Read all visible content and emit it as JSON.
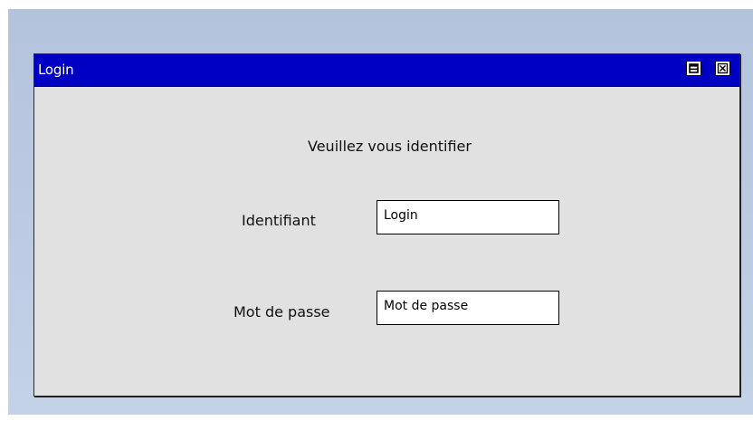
{
  "window": {
    "title": "Login",
    "title_bar_color": "#0000c4",
    "buttons": [
      {
        "name": "restore",
        "icon": "restore-icon"
      },
      {
        "name": "close",
        "icon": "close-icon"
      }
    ]
  },
  "form": {
    "heading": "Veuillez vous identifier",
    "fields": [
      {
        "label": "Identifiant",
        "value": "Login"
      },
      {
        "label": "Mot de passe",
        "value": "Mot de passe"
      }
    ]
  },
  "colors": {
    "desktop": "#bccbe2",
    "window_body": "#e1e1e1",
    "field_background": "#ffffff"
  }
}
